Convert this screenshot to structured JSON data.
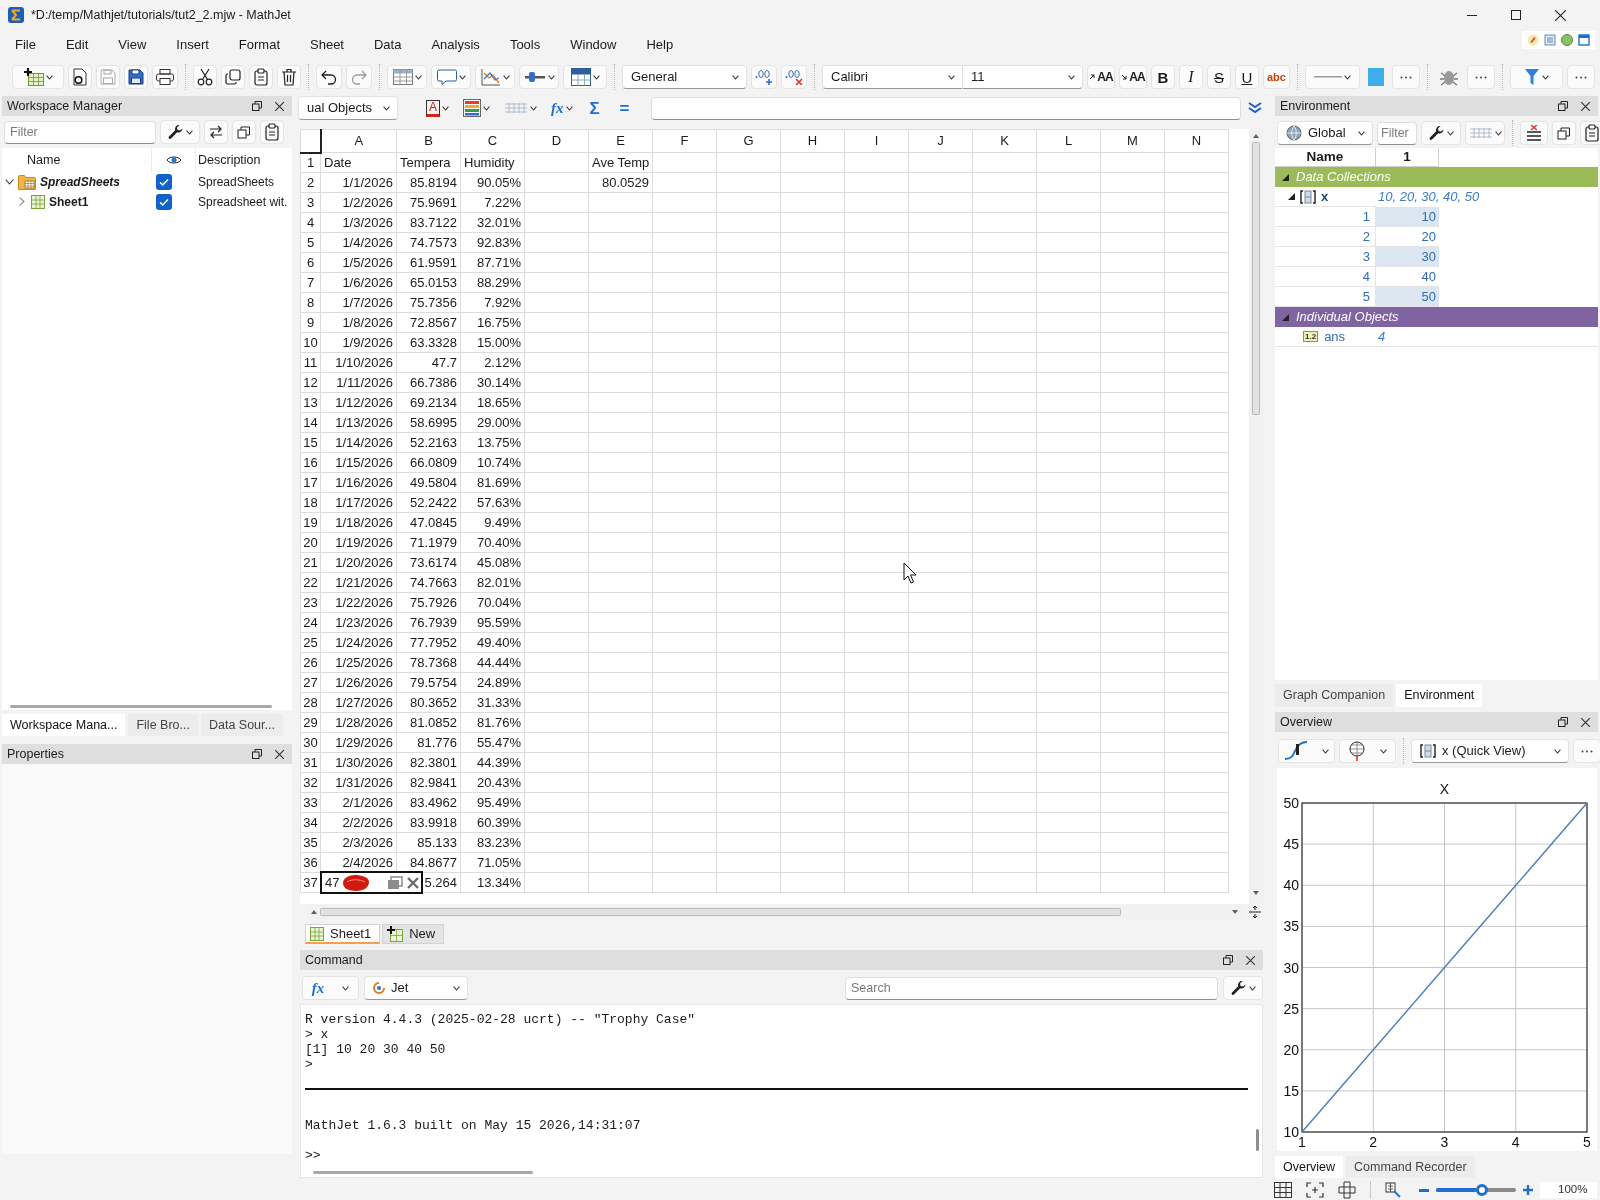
{
  "window": {
    "title": "*D:/temp/Mathjet/tutorials/tut2_2.mjw - MathJet"
  },
  "menu": [
    "File",
    "Edit",
    "View",
    "Insert",
    "Format",
    "Sheet",
    "Data",
    "Analysis",
    "Tools",
    "Window",
    "Help"
  ],
  "toolbar": {
    "number_format": "General",
    "font": "Calibri",
    "font_size": "11",
    "text_format": [
      {
        "label": "AA",
        "kind": "grow"
      },
      {
        "label": "AA",
        "kind": "shrink"
      },
      {
        "label": "B",
        "kind": "bold"
      },
      {
        "label": "I",
        "kind": "italic"
      },
      {
        "label": "S",
        "kind": "strike"
      },
      {
        "label": "U",
        "kind": "underline"
      },
      {
        "label": "abc",
        "kind": "spelling"
      }
    ]
  },
  "workspace_manager": {
    "title": "Workspace Manager",
    "filter": {
      "placeholder": "Filter"
    },
    "columns": [
      "Name",
      "Description"
    ],
    "tree": [
      {
        "name": "SpreadSheets",
        "kind": "folder",
        "description": "SpreadSheets",
        "checked": true,
        "expanded": true,
        "children": [
          {
            "name": "Sheet1",
            "kind": "sheet",
            "description": "Spreadsheet wit.",
            "checked": true,
            "expanded": false
          }
        ]
      }
    ]
  },
  "left_tabs": [
    {
      "label": "Workspace Mana...",
      "selected": true
    },
    {
      "label": "File Bro...",
      "selected": false
    },
    {
      "label": "Data Sour...",
      "selected": false
    }
  ],
  "properties": {
    "title": "Properties"
  },
  "formula_bar": {
    "object_selector": "ual Objects",
    "text_color_label": "A",
    "function_label": "fx",
    "sum_label": "Σ",
    "equals_label": "="
  },
  "sheet": {
    "columns": [
      "A",
      "B",
      "C",
      "D",
      "E",
      "F",
      "G",
      "H",
      "I",
      "J",
      "K",
      "L",
      "M",
      "N"
    ],
    "rows": [
      {
        "number": "1",
        "kind": "text",
        "cells": {
          "A": "Date",
          "B": "Tempera",
          "C": "Humidity",
          "E": "Ave Temp"
        }
      },
      {
        "number": "2",
        "kind": "number",
        "cells": {
          "A": "1/1/2026",
          "B": "85.8194",
          "C": "90.05%",
          "E": "80.0529"
        }
      },
      {
        "number": "3",
        "kind": "number",
        "cells": {
          "A": "1/2/2026",
          "B": "75.9691",
          "C": "7.22%"
        }
      },
      {
        "number": "4",
        "kind": "number",
        "cells": {
          "A": "1/3/2026",
          "B": "83.7122",
          "C": "32.01%"
        }
      },
      {
        "number": "5",
        "kind": "number",
        "cells": {
          "A": "1/4/2026",
          "B": "74.7573",
          "C": "92.83%"
        }
      },
      {
        "number": "6",
        "kind": "number",
        "cells": {
          "A": "1/5/2026",
          "B": "61.9591",
          "C": "87.71%"
        }
      },
      {
        "number": "7",
        "kind": "number",
        "cells": {
          "A": "1/6/2026",
          "B": "65.0153",
          "C": "88.29%"
        }
      },
      {
        "number": "8",
        "kind": "number",
        "cells": {
          "A": "1/7/2026",
          "B": "75.7356",
          "C": "7.92%"
        }
      },
      {
        "number": "9",
        "kind": "number",
        "cells": {
          "A": "1/8/2026",
          "B": "72.8567",
          "C": "16.75%"
        }
      },
      {
        "number": "10",
        "kind": "number",
        "cells": {
          "A": "1/9/2026",
          "B": "63.3328",
          "C": "15.00%"
        }
      },
      {
        "number": "11",
        "kind": "number",
        "cells": {
          "A": "1/10/2026",
          "B": "47.7",
          "C": "2.12%"
        }
      },
      {
        "number": "12",
        "kind": "number",
        "cells": {
          "A": "1/11/2026",
          "B": "66.7386",
          "C": "30.14%"
        }
      },
      {
        "number": "13",
        "kind": "number",
        "cells": {
          "A": "1/12/2026",
          "B": "69.2134",
          "C": "18.65%"
        }
      },
      {
        "number": "14",
        "kind": "number",
        "cells": {
          "A": "1/13/2026",
          "B": "58.6995",
          "C": "29.00%"
        }
      },
      {
        "number": "15",
        "kind": "number",
        "cells": {
          "A": "1/14/2026",
          "B": "52.2163",
          "C": "13.75%"
        }
      },
      {
        "number": "16",
        "kind": "number",
        "cells": {
          "A": "1/15/2026",
          "B": "66.0809",
          "C": "10.74%"
        }
      },
      {
        "number": "17",
        "kind": "number",
        "cells": {
          "A": "1/16/2026",
          "B": "49.5804",
          "C": "81.69%"
        }
      },
      {
        "number": "18",
        "kind": "number",
        "cells": {
          "A": "1/17/2026",
          "B": "52.2422",
          "C": "57.63%"
        }
      },
      {
        "number": "19",
        "kind": "number",
        "cells": {
          "A": "1/18/2026",
          "B": "47.0845",
          "C": "9.49%"
        }
      },
      {
        "number": "20",
        "kind": "number",
        "cells": {
          "A": "1/19/2026",
          "B": "71.1979",
          "C": "70.40%"
        }
      },
      {
        "number": "21",
        "kind": "number",
        "cells": {
          "A": "1/20/2026",
          "B": "73.6174",
          "C": "45.08%"
        }
      },
      {
        "number": "22",
        "kind": "number",
        "cells": {
          "A": "1/21/2026",
          "B": "74.7663",
          "C": "82.01%"
        }
      },
      {
        "number": "23",
        "kind": "number",
        "cells": {
          "A": "1/22/2026",
          "B": "75.7926",
          "C": "70.04%"
        }
      },
      {
        "number": "24",
        "kind": "number",
        "cells": {
          "A": "1/23/2026",
          "B": "76.7939",
          "C": "95.59%"
        }
      },
      {
        "number": "25",
        "kind": "number",
        "cells": {
          "A": "1/24/2026",
          "B": "77.7952",
          "C": "49.40%"
        }
      },
      {
        "number": "26",
        "kind": "number",
        "cells": {
          "A": "1/25/2026",
          "B": "78.7368",
          "C": "44.44%"
        }
      },
      {
        "number": "27",
        "kind": "number",
        "cells": {
          "A": "1/26/2026",
          "B": "79.5754",
          "C": "24.89%"
        }
      },
      {
        "number": "28",
        "kind": "number",
        "cells": {
          "A": "1/27/2026",
          "B": "80.3652",
          "C": "31.33%"
        }
      },
      {
        "number": "29",
        "kind": "number",
        "cells": {
          "A": "1/28/2026",
          "B": "81.0852",
          "C": "81.76%"
        }
      },
      {
        "number": "30",
        "kind": "number",
        "cells": {
          "A": "1/29/2026",
          "B": "81.776",
          "C": "55.47%"
        }
      },
      {
        "number": "31",
        "kind": "number",
        "cells": {
          "A": "1/30/2026",
          "B": "82.3801",
          "C": "44.39%"
        }
      },
      {
        "number": "32",
        "kind": "number",
        "cells": {
          "A": "1/31/2026",
          "B": "82.9841",
          "C": "20.43%"
        }
      },
      {
        "number": "33",
        "kind": "number",
        "cells": {
          "A": "2/1/2026",
          "B": "83.4962",
          "C": "95.49%"
        }
      },
      {
        "number": "34",
        "kind": "number",
        "cells": {
          "A": "2/2/2026",
          "B": "83.9918",
          "C": "60.39%"
        }
      },
      {
        "number": "35",
        "kind": "number",
        "cells": {
          "A": "2/3/2026",
          "B": "85.133",
          "C": "83.23%"
        }
      },
      {
        "number": "36",
        "kind": "number",
        "cells": {
          "A": "2/4/2026",
          "B": "84.8677",
          "C": "71.05%"
        }
      },
      {
        "number": "37",
        "kind": "number",
        "cells": {
          "B": "5.264",
          "C": "13.34%"
        },
        "cell_editor": {
          "value": "47"
        }
      }
    ]
  },
  "sheet_tabs": [
    {
      "label": "Sheet1",
      "kind": "sheet",
      "selected": true
    },
    {
      "label": "New",
      "kind": "add",
      "selected": false
    }
  ],
  "command": {
    "title": "Command",
    "function_label": "fx",
    "engine": "Jet",
    "search": {
      "placeholder": "Search"
    },
    "output": [
      "R version 4.4.3 (2025-02-28 ucrt) -- \"Trophy Case\"",
      "> x",
      "[1] 10 20 30 40 50",
      ">"
    ],
    "banner": "MathJet 1.6.3 built on May 15 2026,14:31:07",
    "prompt": ">>"
  },
  "environment": {
    "title": "Environment",
    "scope": "Global",
    "filter": {
      "placeholder": "Filter"
    },
    "columns": [
      "Name",
      "1"
    ],
    "groups": [
      {
        "name": "Data Collections",
        "color": "#9bbb59",
        "expanded": true,
        "items": [
          {
            "name": "x",
            "kind": "vector",
            "summary": "10, 20, 30, 40, 50",
            "expanded": true,
            "elements": [
              {
                "index": "1",
                "value": "10"
              },
              {
                "index": "2",
                "value": "20"
              },
              {
                "index": "3",
                "value": "30"
              },
              {
                "index": "4",
                "value": "40"
              },
              {
                "index": "5",
                "value": "50"
              }
            ]
          }
        ]
      },
      {
        "name": "Individual Objects",
        "color": "#8064a2",
        "expanded": true,
        "items": [
          {
            "name": "ans",
            "kind": "scalar",
            "type_badge": "1.2",
            "summary": "4"
          }
        ]
      }
    ]
  },
  "right_tabs": [
    {
      "label": "Graph Companion",
      "selected": false
    },
    {
      "label": "Environment",
      "selected": true
    }
  ],
  "overview": {
    "title": "Overview",
    "view": "x (Quick View)",
    "chart_data": {
      "type": "line",
      "title": "X",
      "x": [
        1,
        2,
        3,
        4,
        5
      ],
      "series": [
        {
          "color": "#4a7ebb",
          "values": [
            10,
            20,
            30,
            40,
            50
          ]
        }
      ],
      "xlim": [
        1,
        5
      ],
      "ylim": [
        10,
        50
      ],
      "xticks": [
        1,
        2,
        3,
        4,
        5
      ],
      "yticks": [
        10,
        15,
        20,
        25,
        30,
        35,
        40,
        45,
        50
      ],
      "grid": true
    }
  },
  "overview_tabs": [
    {
      "label": "Overview",
      "selected": true
    },
    {
      "label": "Command Recorder",
      "selected": false
    }
  ],
  "status_bar": {
    "zoom": {
      "level": 0.5,
      "reading": "100%"
    }
  }
}
